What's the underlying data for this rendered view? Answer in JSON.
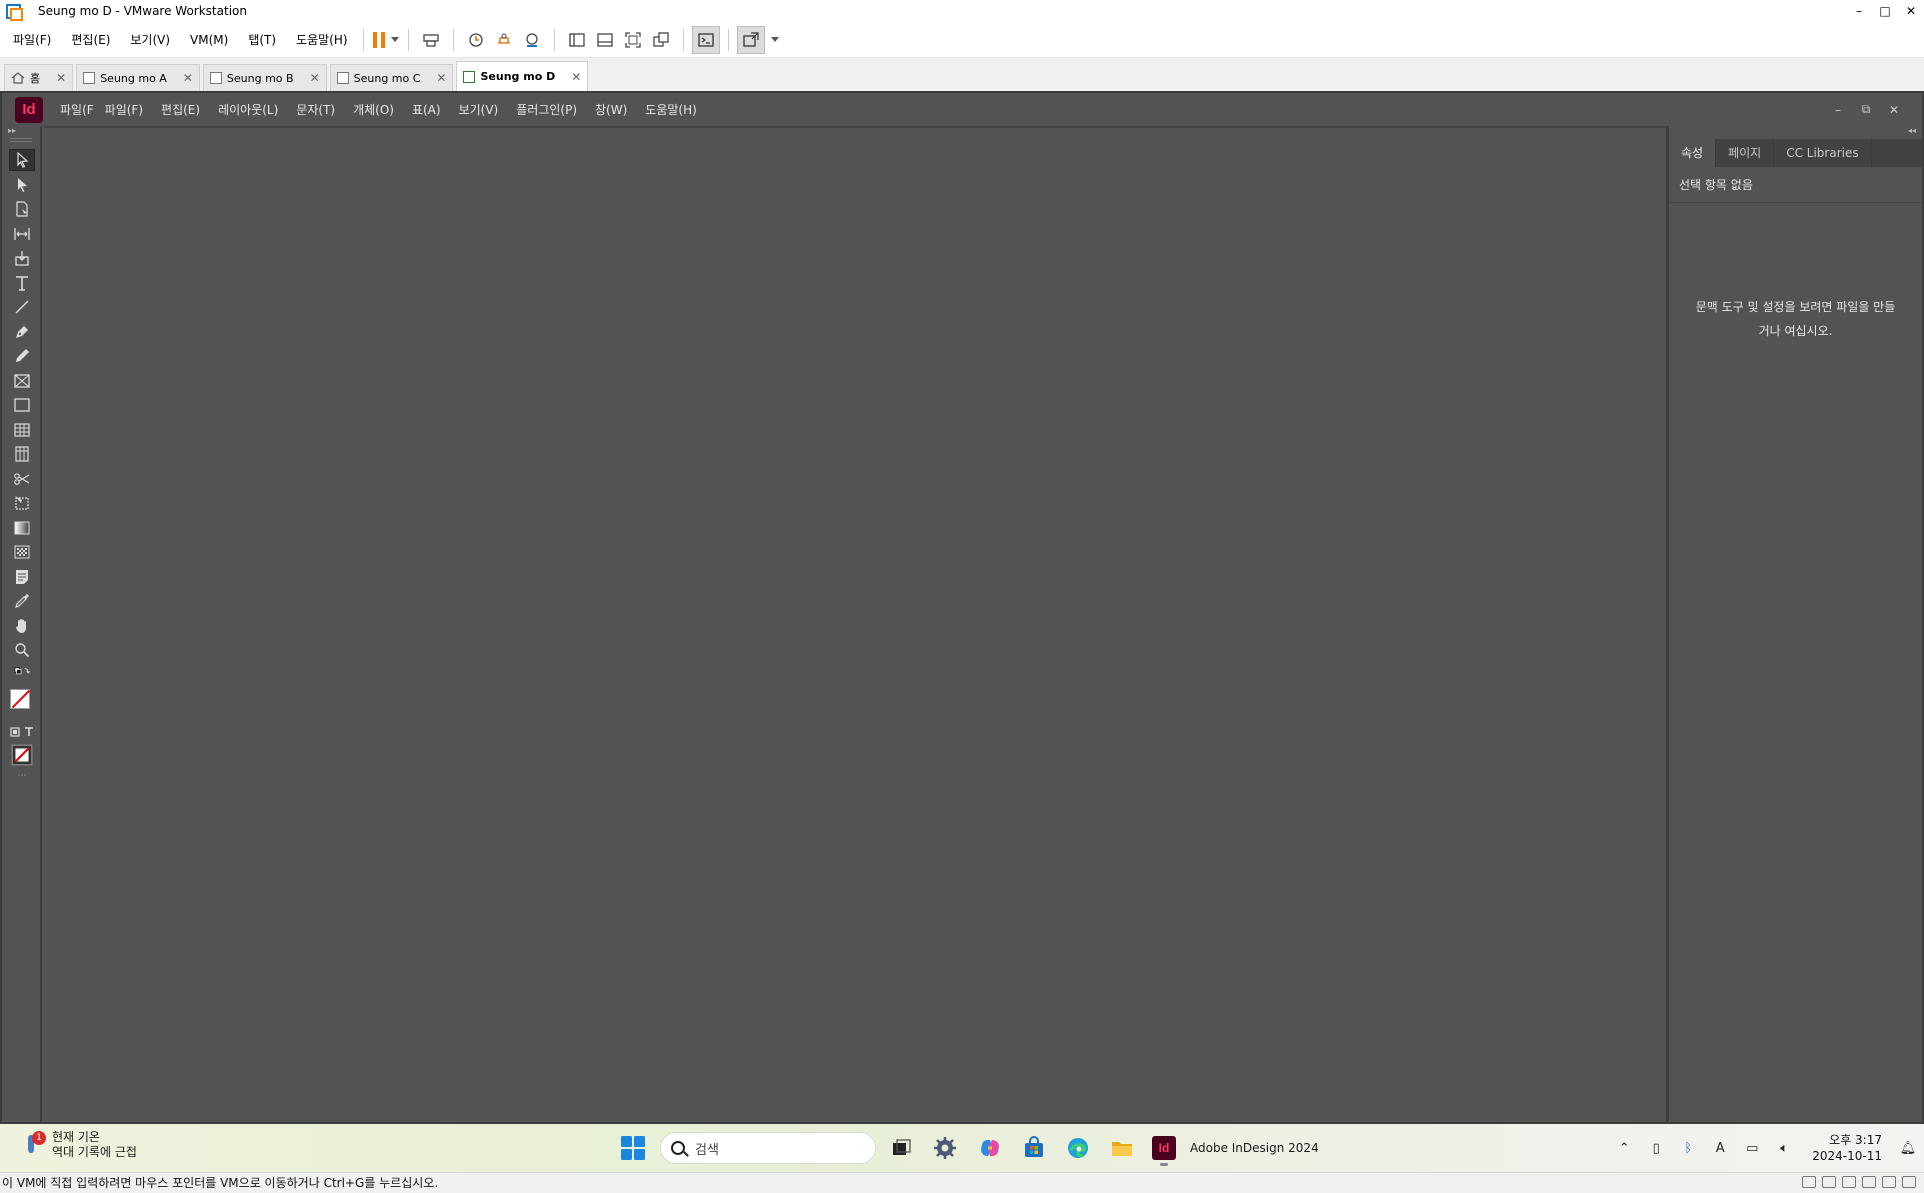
{
  "window": {
    "title": "Seung mo D - VMware Workstation",
    "controls": [
      "–",
      "□",
      "✕"
    ]
  },
  "vm_menu": [
    "파일(F)",
    "편집(E)",
    "보기(V)",
    "VM(M)",
    "탭(T)",
    "도움말(H)"
  ],
  "vm_tabs": [
    {
      "label": "홈",
      "icon": "home-icon"
    },
    {
      "label": "Seung mo A",
      "icon": "vm-icon"
    },
    {
      "label": "Seung mo B",
      "icon": "vm-icon"
    },
    {
      "label": "Seung mo C",
      "icon": "vm-icon"
    },
    {
      "label": "Seung mo D",
      "icon": "vm-running-icon",
      "active": true
    }
  ],
  "indesign": {
    "logo": "Id",
    "menu": [
      "파일(F",
      "파일(F)",
      "편집(E)",
      "레이아웃(L)",
      "문자(T)",
      "개체(O)",
      "표(A)",
      "보기(V)",
      "플러그인(P)",
      "창(W)",
      "도움말(H)"
    ],
    "window_controls": [
      "–",
      "⧉",
      "✕"
    ],
    "panel_tabs": [
      "속성",
      "페이지",
      "CC Libraries"
    ],
    "no_selection": "선택 항목 없음",
    "empty_message": "문맥 도구 및 설정을 보려면 파일을 만들거나 여십시오.",
    "tools": [
      "selection-tool-icon",
      "direct-selection-tool-icon",
      "page-tool-icon",
      "gap-tool-icon",
      "content-collector-icon",
      "type-tool-icon",
      "line-tool-icon",
      "pen-tool-icon",
      "pencil-tool-icon",
      "rectangle-frame-tool-icon",
      "rectangle-tool-icon",
      "table-tool-icon",
      "grid-tool-icon",
      "scissors-tool-icon",
      "free-transform-tool-icon",
      "gradient-swatch-tool-icon",
      "gradient-feather-tool-icon",
      "note-tool-icon",
      "eyedropper-tool-icon",
      "hand-tool-icon",
      "zoom-tool-icon"
    ]
  },
  "taskbar": {
    "weather_title": "현재 기온",
    "weather_sub": "역대 기록에 근접",
    "weather_badge": "1",
    "search_placeholder": "검색",
    "active_app": "Adobe InDesign 2024",
    "time": "오후 3:17",
    "date": "2024-10-11"
  },
  "status_text": "이 VM에 직접 입력하려면 마우스 포인터를 VM으로 이동하거나 Ctrl+G를 누르십시오.",
  "colors": {
    "indesign_bg": "#535353",
    "indesign_logo_bg": "#49021f",
    "indesign_logo_fg": "#ff3366",
    "vm_pause": "#f07c00"
  }
}
